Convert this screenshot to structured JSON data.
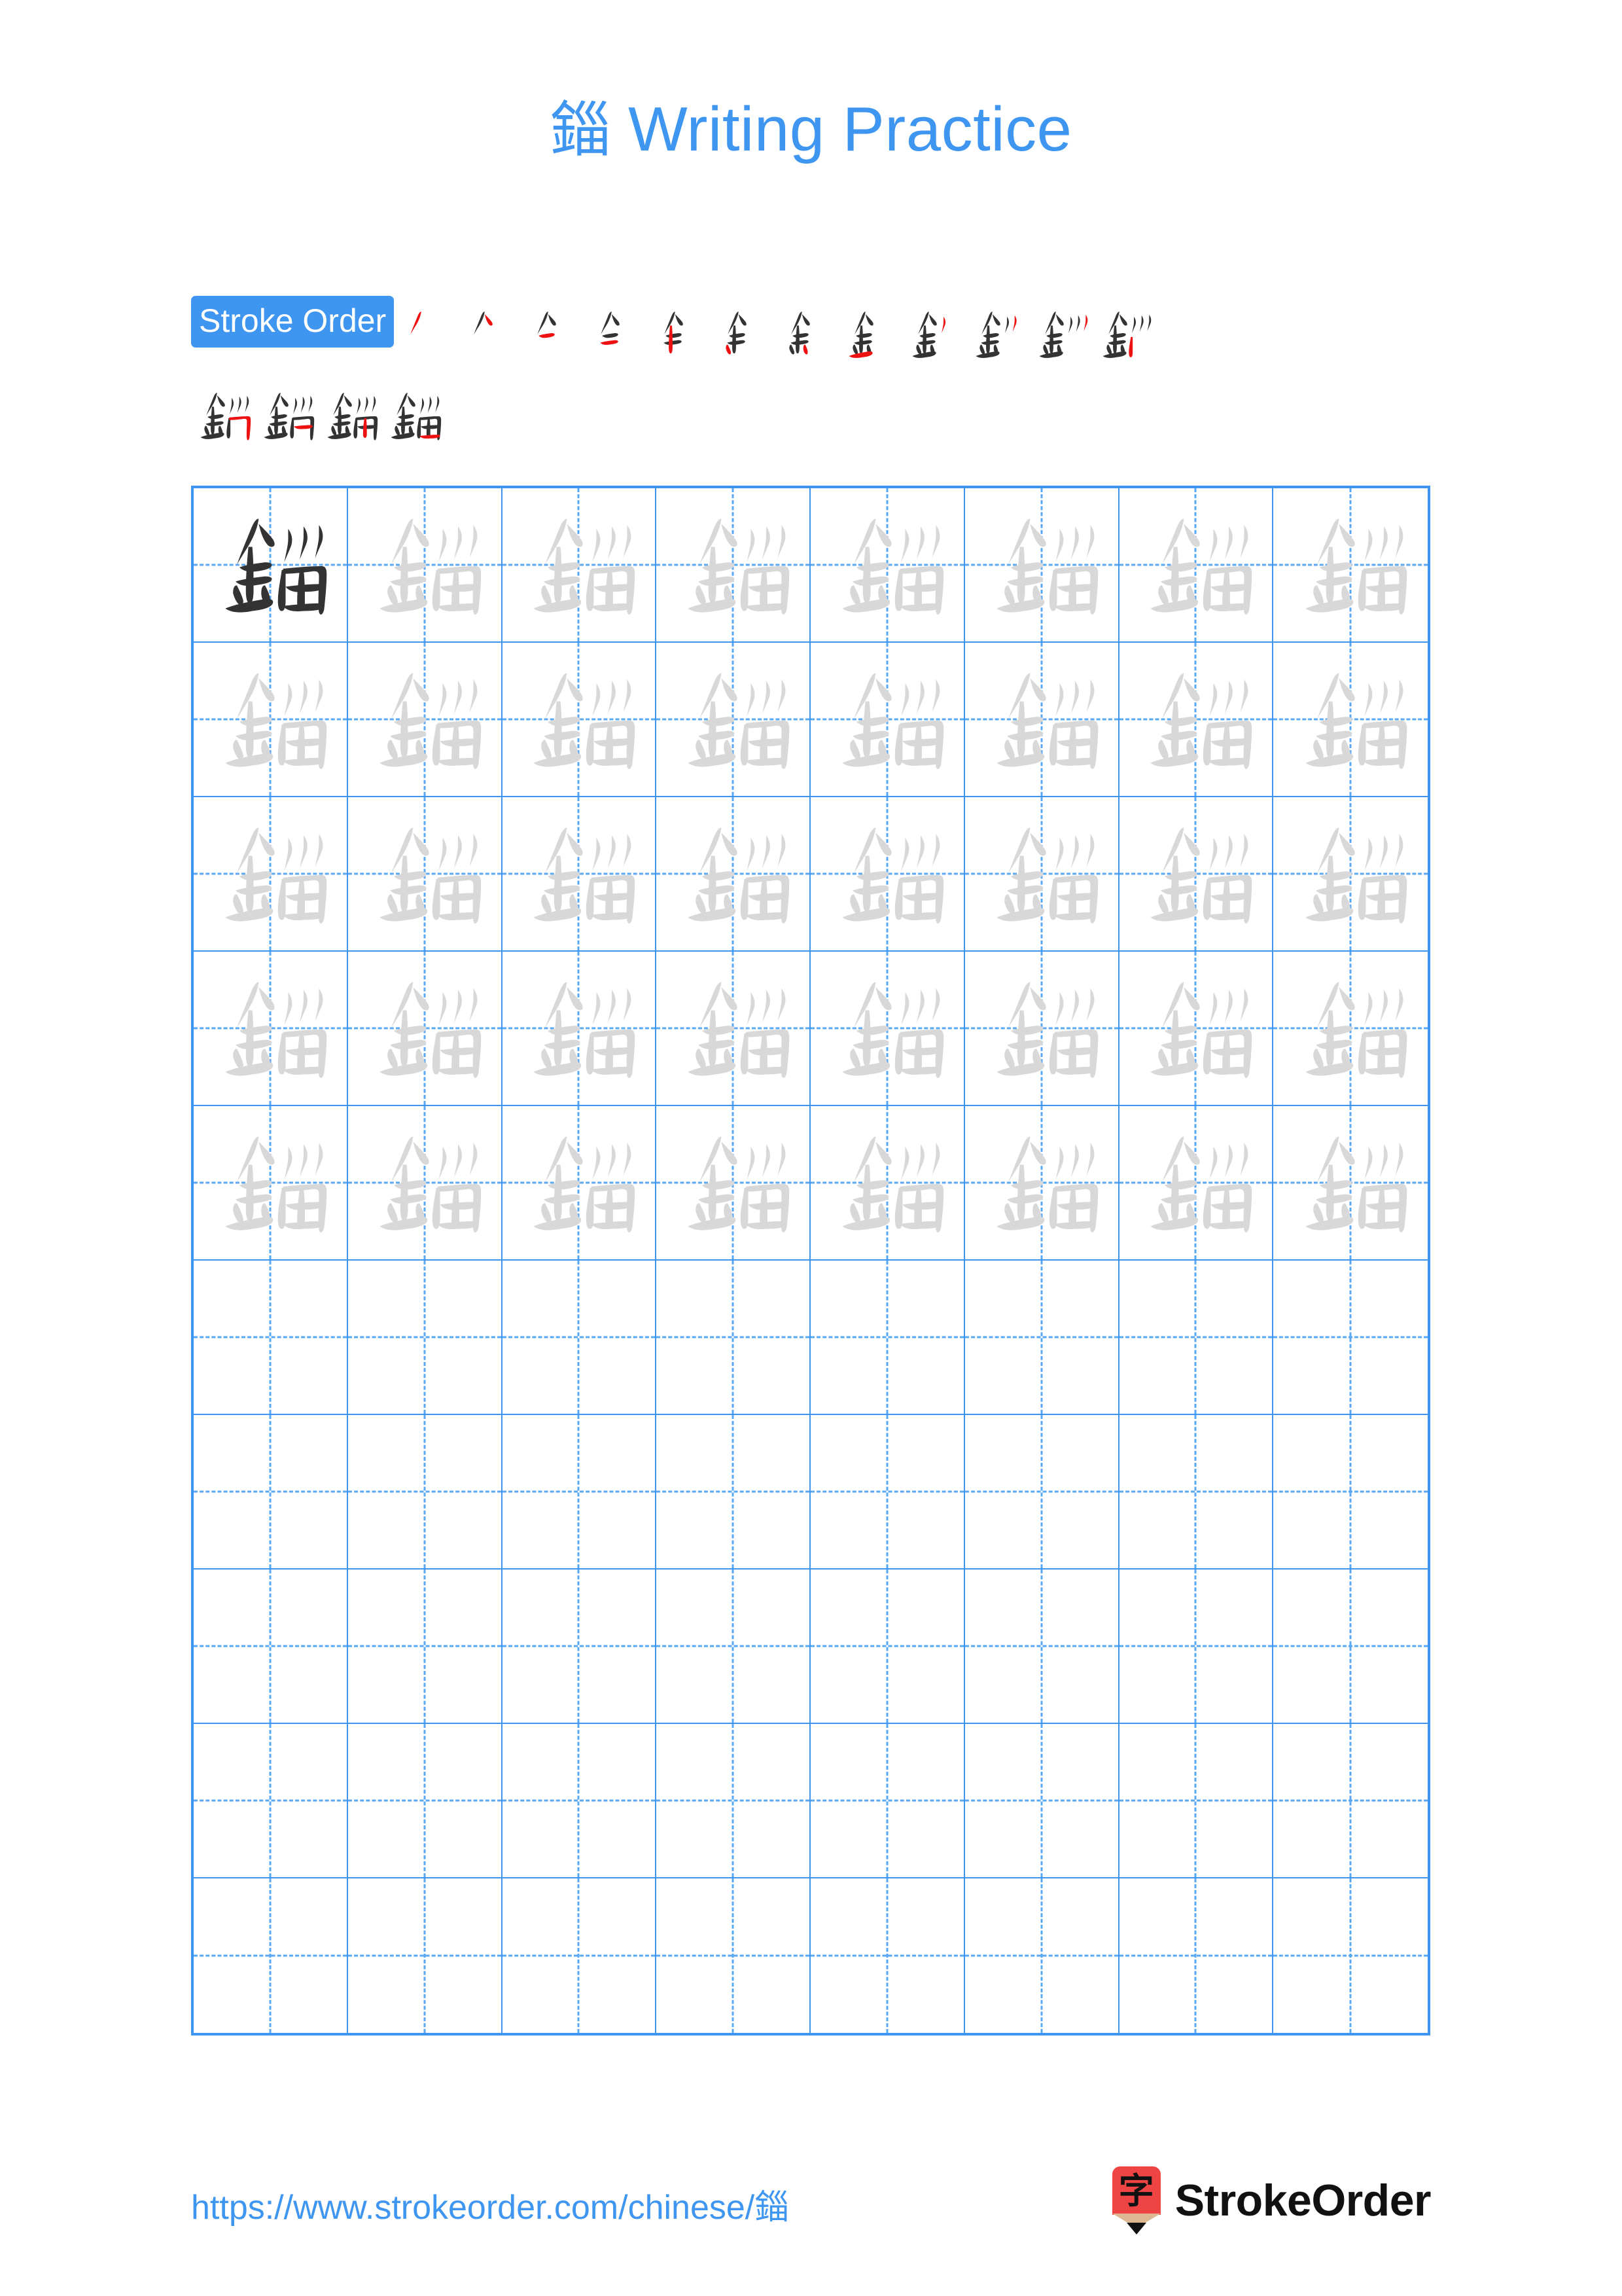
{
  "document": {
    "type": "chinese-character-writing-practice-worksheet",
    "character": "錙",
    "title_text": "錙 Writing Practice",
    "title_character": "錙",
    "title_suffix": " Writing Practice",
    "page_background": "#ffffff"
  },
  "colors": {
    "accent_blue": "#3f96f0",
    "grid_line": "#3f96f0",
    "grid_dash": "#5aa8f2",
    "ink_dark": "#333333",
    "ink_light": "#d8d8d8",
    "new_stroke_red": "#ee1111",
    "logo_red": "#ef4444",
    "logo_wood": "#ddb892"
  },
  "stroke_order": {
    "badge_label": "Stroke Order",
    "total_strokes": 16,
    "row1_count": 12,
    "row2_count": 4,
    "steps": [
      {
        "n": 1,
        "char": "丿"
      },
      {
        "n": 2,
        "char": "𠂉"
      },
      {
        "n": 3,
        "char": "𠂈"
      },
      {
        "n": 4,
        "char": "𠆢"
      },
      {
        "n": 5,
        "char": "full"
      },
      {
        "n": 6,
        "char": "full"
      },
      {
        "n": 7,
        "char": "full"
      },
      {
        "n": 8,
        "char": "金"
      },
      {
        "n": 9,
        "char": "金丿"
      },
      {
        "n": 10,
        "char": "金巛1"
      },
      {
        "n": 11,
        "char": "金巛2"
      },
      {
        "n": 12,
        "char": "金巛"
      },
      {
        "n": 13,
        "char": "錙-13"
      },
      {
        "n": 14,
        "char": "錙-14"
      },
      {
        "n": 15,
        "char": "錙-15"
      },
      {
        "n": 16,
        "char": "錙"
      }
    ]
  },
  "practice_grid": {
    "columns": 8,
    "rows": 10,
    "filled_rows": 5,
    "empty_rows": 5,
    "total_cells": 80,
    "model_cell_index": 0,
    "traced_cells": 39,
    "blank_cells": 40,
    "cell_character": "錙"
  },
  "footer": {
    "url": "https://www.strokeorder.com/chinese/錙",
    "logo_character": "字",
    "logo_text": "StrokeOrder"
  }
}
